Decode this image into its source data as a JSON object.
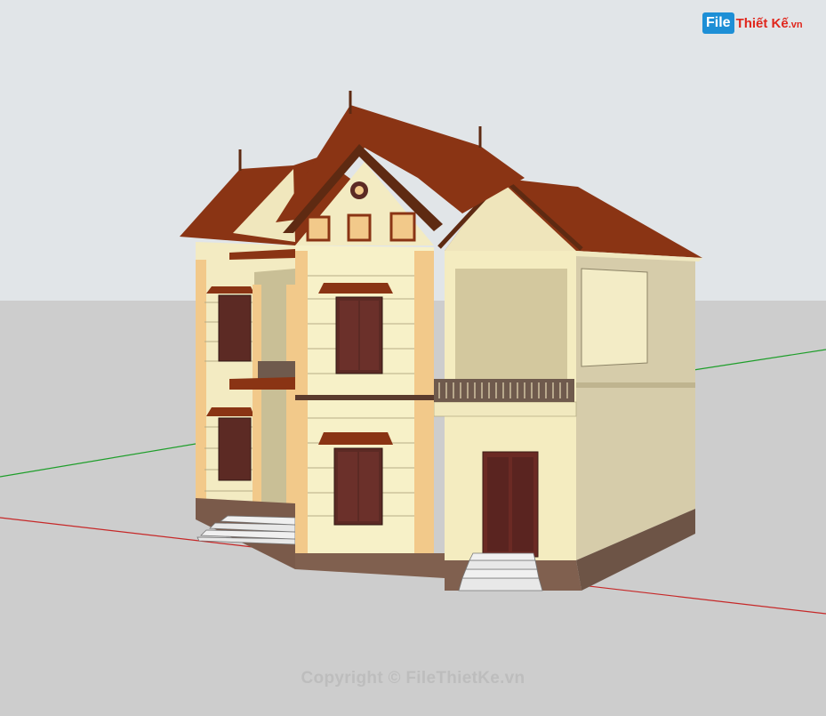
{
  "logo": {
    "file_text": "File",
    "rest_text": "Thiết Kế",
    "tld_text": ".vn"
  },
  "watermark": {
    "copyright_text": "Copyright © FileThietKe.vn"
  },
  "scene": {
    "sky_color": "#dfe3e6",
    "ground_color": "#cfcfcf",
    "axis_green": "#1e9e2a",
    "axis_red": "#c62828",
    "roof_color": "#8a3414",
    "wall_color": "#f7f1c8",
    "trim_color": "#f2c98a",
    "base_color": "#7a5a4a"
  }
}
